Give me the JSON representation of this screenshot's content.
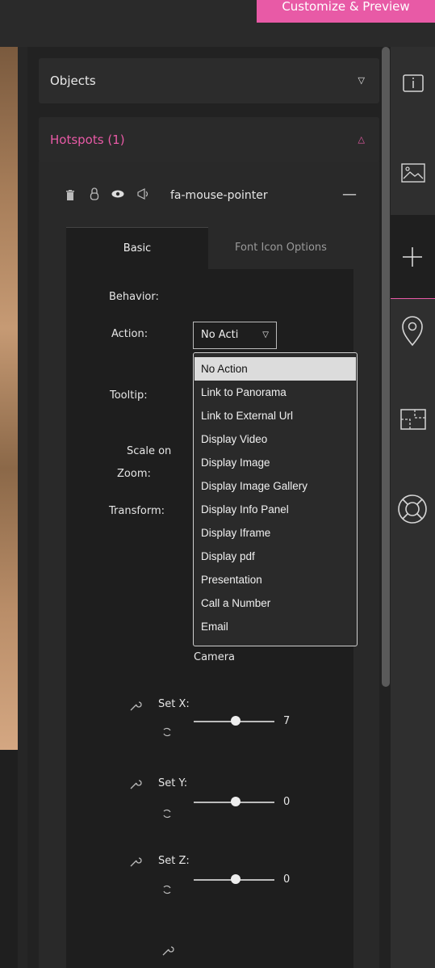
{
  "topbar": {
    "customize_label": "Customize & Preview"
  },
  "panel": {
    "objects_label": "Objects",
    "hotspots_label": "Hotspots (1)",
    "chevron_down": "▽",
    "chevron_up": "△"
  },
  "hotspot": {
    "name": "fa-mouse-pointer",
    "collapse": "—",
    "icons": {
      "delete": "🗑",
      "lock": "🔒",
      "eye": "👁",
      "megaphone": "📢"
    }
  },
  "tabs": {
    "basic": "Basic",
    "font_icon_options": "Font Icon Options"
  },
  "form": {
    "behavior_label": "Behavior:",
    "action_label": "Action:",
    "tooltip_label": "Tooltip:",
    "scale_label": "Scale on",
    "zoom_label": "Zoom:",
    "transform_label": "Transform:",
    "camera_label": "Camera",
    "action_value": "No Acti",
    "set_x_label": "Set X:",
    "set_x_value": "7",
    "set_y_label": "Set Y:",
    "set_y_value": "0",
    "set_z_label": "Set Z:",
    "set_z_value": "0"
  },
  "dropdown": {
    "options": [
      "No Action",
      "Link to Panorama",
      "Link to External Url",
      "Display Video",
      "Display Image",
      "Display Image Gallery",
      "Display Info Panel",
      "Display Iframe",
      "Display pdf",
      "Presentation",
      "Call a Number",
      "Email"
    ],
    "selected": "No Action"
  },
  "colors": {
    "accent": "#e85aa6",
    "panel": "#222222",
    "rail": "#2f2f2f"
  }
}
